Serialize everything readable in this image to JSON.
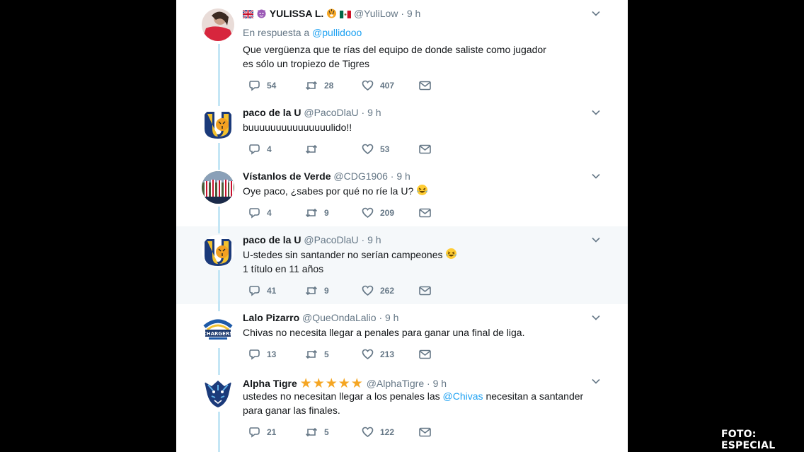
{
  "tweets": [
    {
      "name": "YULISSA L.",
      "handle": "@YuliLow",
      "time": "9 h",
      "reply_prefix": "En respuesta a",
      "reply_to": "@pullidooo",
      "lines": [
        "Que vergüenza que te rías del equipo de donde saliste como jugador",
        "es sólo un tropiezo de Tigres"
      ],
      "replies": "54",
      "retweets": "28",
      "likes": "407",
      "avatar": "woman-red-shirt"
    },
    {
      "name": "paco de la U",
      "handle": "@PacoDlaU",
      "time": "9 h",
      "lines": [
        "buuuuuuuuuuuuuuulido!!"
      ],
      "replies": "4",
      "retweets": "",
      "likes": "53",
      "avatar": "tigres-u-logo"
    },
    {
      "name": "Vístanlos de Verde",
      "handle": "@CDG1906",
      "time": "9 h",
      "lines": [
        "Oye paco, ¿sabes por qué no ríe la U?"
      ],
      "replies": "4",
      "retweets": "9",
      "likes": "209",
      "avatar": "chivas-players-photo"
    },
    {
      "name": "paco de la U",
      "handle": "@PacoDlaU",
      "time": "9 h",
      "lines": [
        "U-stedes sin santander no serían campeones",
        "1 título en 11 años"
      ],
      "replies": "41",
      "retweets": "9",
      "likes": "262",
      "avatar": "tigres-u-logo"
    },
    {
      "name": "Lalo Pizarro",
      "handle": "@QueOndaLalio",
      "time": "9 h",
      "lines": [
        "Chivas no necesita llegar a penales para ganar una final de liga."
      ],
      "replies": "13",
      "retweets": "5",
      "likes": "213",
      "avatar": "chargers-logo"
    },
    {
      "name": "Alpha Tigre",
      "stars": "★★★★★",
      "handle": "@AlphaTigre",
      "time": "9 h",
      "line1_pre": "ustedes no necesitan llegar a los penales las",
      "line1_mention": "@Chivas",
      "line1_post": "necesitan a santander",
      "line2": "para ganar las finales.",
      "replies": "21",
      "retweets": "5",
      "likes": "122",
      "avatar": "tiger-face-logo"
    }
  ],
  "sep": "·",
  "credit": "FOTO: ESPECIAL",
  "colors": {
    "link": "#1da1f2",
    "muted": "#657786",
    "thread": "#c4e6f5",
    "highlight": "#f5f8fa",
    "star": "#f5a623"
  }
}
